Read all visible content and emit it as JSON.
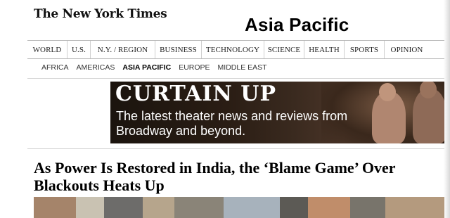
{
  "masthead": {
    "logo": "The New York Times",
    "section": "Asia Pacific"
  },
  "topnav": {
    "tabs": [
      {
        "label": "WORLD"
      },
      {
        "label": "U.S."
      },
      {
        "label": "N.Y. / REGION"
      },
      {
        "label": "BUSINESS"
      },
      {
        "label": "TECHNOLOGY"
      },
      {
        "label": "SCIENCE"
      },
      {
        "label": "HEALTH"
      },
      {
        "label": "SPORTS"
      },
      {
        "label": "OPINION"
      }
    ]
  },
  "subnav": {
    "items": [
      {
        "label": "AFRICA"
      },
      {
        "label": "AMERICAS"
      },
      {
        "label": "ASIA PACIFIC"
      },
      {
        "label": "EUROPE"
      },
      {
        "label": "MIDDLE EAST"
      }
    ]
  },
  "ad": {
    "headline": "CURTAIN UP",
    "subline": "The latest theater news and reviews from Broadway and beyond."
  },
  "article": {
    "headline": "As Power Is Restored in India, the ‘Blame Game’ Over Blackouts Heats Up"
  },
  "colors": {
    "ad_background": "#2a1d14",
    "border": "#b8b8b8"
  }
}
